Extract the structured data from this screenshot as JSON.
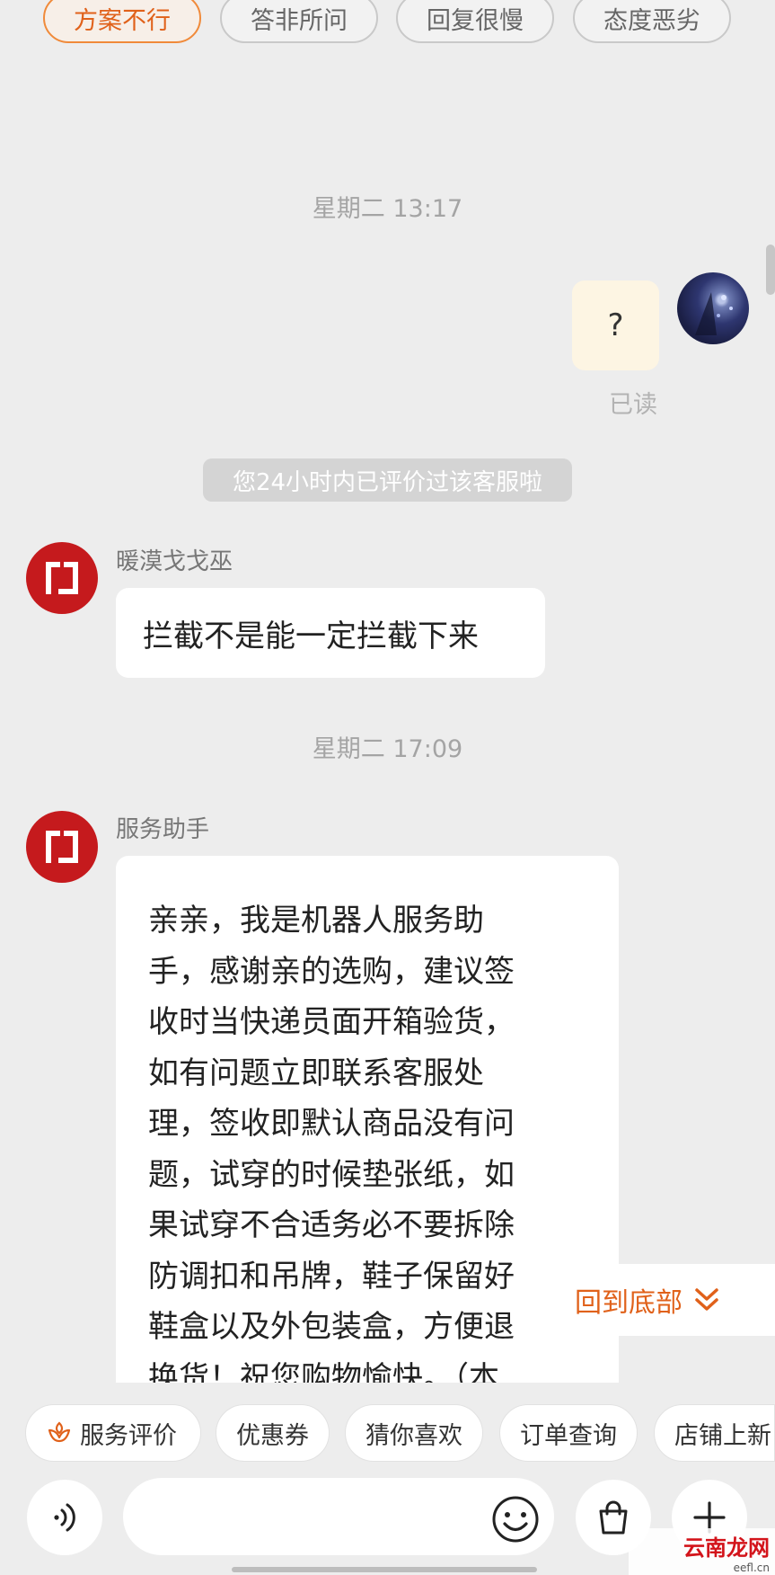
{
  "feedback_chips": [
    "方案不行",
    "答非所问",
    "回复很慢",
    "态度恶劣"
  ],
  "timestamps": [
    "星期二 13:17",
    "星期二 17:09"
  ],
  "user_message": {
    "text": "?",
    "status": "已读"
  },
  "system_notice": "您24小时内已评价过该客服啦",
  "messages": [
    {
      "sender": "暖漠戈戈巫",
      "text": "拦截不是能一定拦截下来"
    },
    {
      "sender": "服务助手",
      "lines": [
        "亲亲，我是机器人服务助",
        "手，感谢亲的选购，建议签",
        "收时当快递员面开箱验货，",
        "如有问题立即联系客服处",
        "理，签收即默认商品没有问",
        "题，试穿的时候垫张纸，如",
        "果试穿不合适务必不要拆除",
        "防调扣和吊牌，鞋子保留好",
        "鞋盒以及外包装盒，方便退",
        "换货！祝您购物愉快。（本"
      ]
    }
  ],
  "back_to_bottom": "回到底部",
  "quick_actions": [
    "服务评价",
    "优惠券",
    "猜你喜欢",
    "订单查询",
    "店铺上新"
  ],
  "input": {
    "placeholder": ""
  },
  "icons": {
    "voice": "voice-icon",
    "emoji": "emoji-icon",
    "shop": "shopping-bag-icon",
    "more": "plus-icon",
    "rate": "flower-icon",
    "scroll_down": "chevron-double-down-icon"
  },
  "colors": {
    "accent": "#e0611a",
    "shop_avatar": "#c51a1d",
    "user_bubble": "#fdf5e3",
    "background": "#ededed"
  },
  "watermark": {
    "title": "云南龙网",
    "subtitle": "eefl.cn"
  }
}
